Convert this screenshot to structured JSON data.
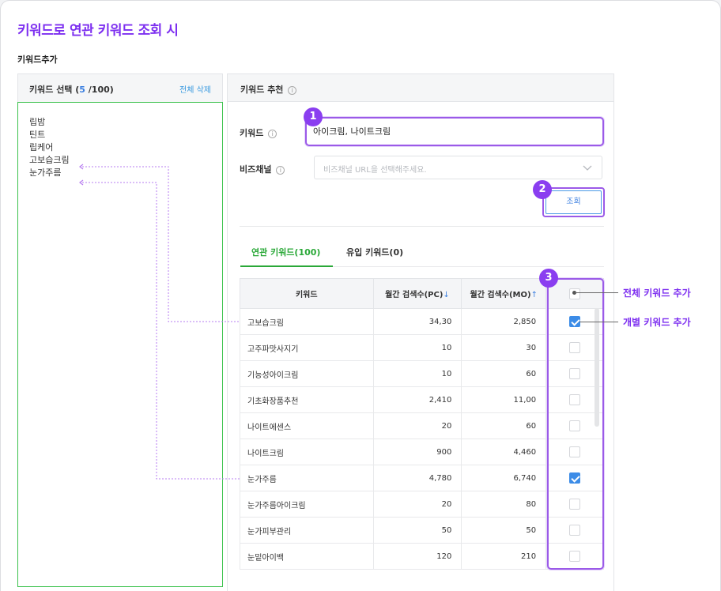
{
  "page_title": "키워드로 연관 키워드 조회 시",
  "section_label": "키워드추가",
  "left_panel": {
    "title_prefix": "키워드 선택 (",
    "selected_count": "5",
    "title_suffix": " /100)",
    "clear_all": "전체 삭제",
    "selected_keywords": [
      "립밤",
      "틴트",
      "립케어",
      "고보습크림",
      "눈가주름"
    ]
  },
  "right_panel": {
    "title": "키워드 추천",
    "keyword_label": "키워드",
    "keyword_value": "아이크림, 나이트크림",
    "biz_label": "비즈채널",
    "biz_placeholder": "비즈채널 URL을 선택해주세요.",
    "search_button": "조회",
    "tabs": [
      "연관 키워드(100)",
      "유입 키워드(0)"
    ],
    "table": {
      "headers": [
        "키워드",
        "월간 검색수(PC)",
        "월간 검색수(MO)"
      ],
      "sort_pc": "↓",
      "sort_mo": "↑",
      "rows": [
        {
          "keyword": "고보습크림",
          "pc": "34,30",
          "mo": "2,850",
          "checked": true
        },
        {
          "keyword": "고주파맛사지기",
          "pc": "10",
          "mo": "30",
          "checked": false
        },
        {
          "keyword": "기능성아이크림",
          "pc": "10",
          "mo": "60",
          "checked": false
        },
        {
          "keyword": "기초화장품추천",
          "pc": "2,410",
          "mo": "11,00",
          "checked": false
        },
        {
          "keyword": "나이트에센스",
          "pc": "20",
          "mo": "60",
          "checked": false
        },
        {
          "keyword": "나이트크림",
          "pc": "900",
          "mo": "4,460",
          "checked": false
        },
        {
          "keyword": "눈가주름",
          "pc": "4,780",
          "mo": "6,740",
          "checked": true
        },
        {
          "keyword": "눈가주름아이크림",
          "pc": "20",
          "mo": "80",
          "checked": false
        },
        {
          "keyword": "눈가피부관리",
          "pc": "50",
          "mo": "50",
          "checked": false
        },
        {
          "keyword": "눈밑아이백",
          "pc": "120",
          "mo": "210",
          "checked": false
        }
      ]
    }
  },
  "annotations": {
    "badge_1": "1",
    "badge_2": "2",
    "badge_3": "3",
    "callout_all": "전체 키워드 추가",
    "callout_each": "개별 키워드 추가"
  },
  "colors": {
    "accent_purple": "#7d2ff0",
    "tab_green": "#2aa838",
    "selection_border_green": "#3cc24d",
    "link_blue": "#3b7fe0",
    "checkbox_blue": "#3c8ce7"
  }
}
